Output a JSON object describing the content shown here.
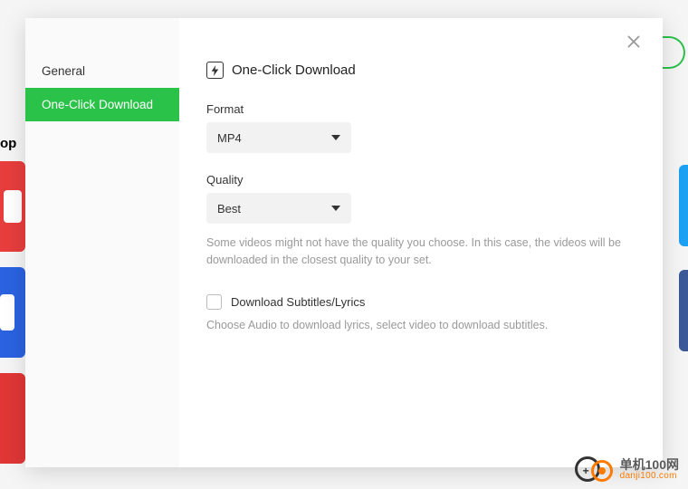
{
  "bg": {
    "label": "op"
  },
  "sidebar": {
    "items": [
      {
        "label": "General"
      },
      {
        "label": "One-Click Download"
      }
    ]
  },
  "content": {
    "title": "One-Click Download",
    "format": {
      "label": "Format",
      "value": "MP4"
    },
    "quality": {
      "label": "Quality",
      "value": "Best",
      "hint": "Some videos might not have the quality you choose. In this case, the videos will be downloaded in the closest quality to your set."
    },
    "subtitles": {
      "label": "Download Subtitles/Lyrics",
      "hint": "Choose Audio to download lyrics, select video to download subtitles."
    }
  },
  "watermark": {
    "cn": "单机100网",
    "url": "danji100.com"
  }
}
